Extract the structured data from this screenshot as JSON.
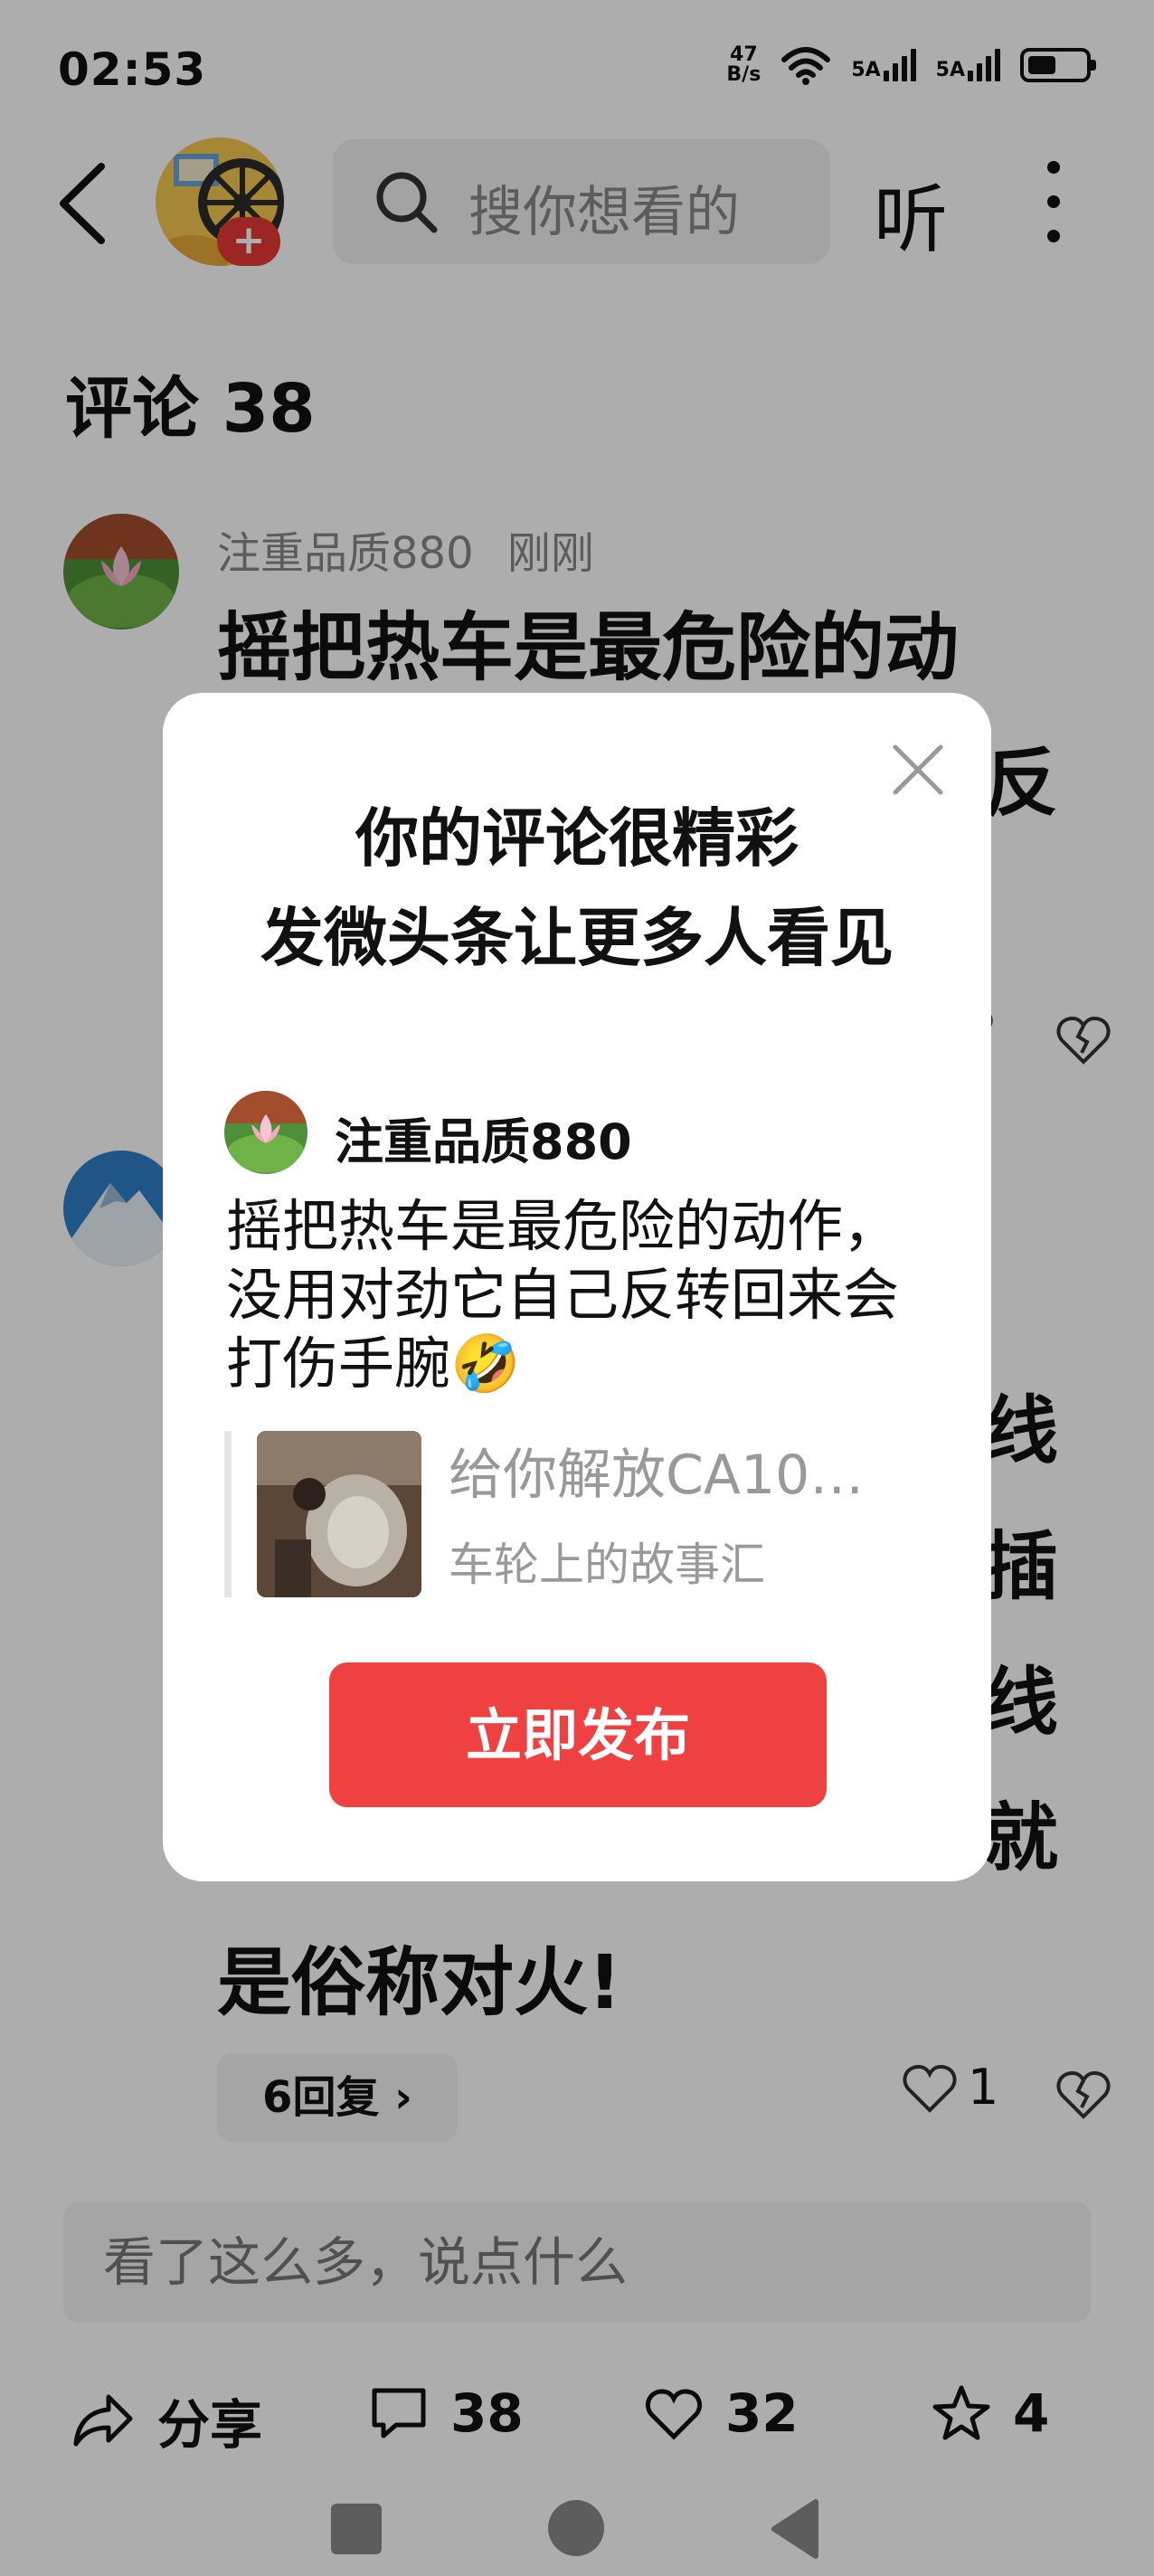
{
  "status_bar": {
    "time": "02:53",
    "net_speed_top": "47",
    "net_speed_bottom": "B/s",
    "sim1_label": "5A",
    "sim2_label": "5A",
    "battery_level": 0.45
  },
  "header": {
    "search_placeholder": "搜你想看的",
    "listen_label": "听",
    "badge_symbol": "+"
  },
  "comments": {
    "title": "评论 38",
    "items": [
      {
        "user": "注重品质880",
        "time": "刚刚",
        "text_line1": "摇把热车是最危险的动",
        "text_partial": "反"
      },
      {
        "text_fragments": [
          "线",
          "插",
          "线",
          "就"
        ],
        "text_last_line": "是俗称对火!",
        "reply_label": "6回复",
        "likes": "1"
      }
    ]
  },
  "input": {
    "placeholder": "看了这么多，说点什么"
  },
  "bottom_bar": {
    "share_label": "分享",
    "comment_count": "38",
    "like_count": "32",
    "favorite_count": "4"
  },
  "modal": {
    "title_line1": "你的评论很精彩",
    "title_line2": "发微头条让更多人看见",
    "user": "注重品质880",
    "text": "摇把热车是最危险的动作，没用对劲它自己反转回来会打伤手腕",
    "emoji": "🤣",
    "quote_title": "给你解放CA10…",
    "quote_source": "车轮上的故事汇",
    "publish_label": "立即发布"
  }
}
